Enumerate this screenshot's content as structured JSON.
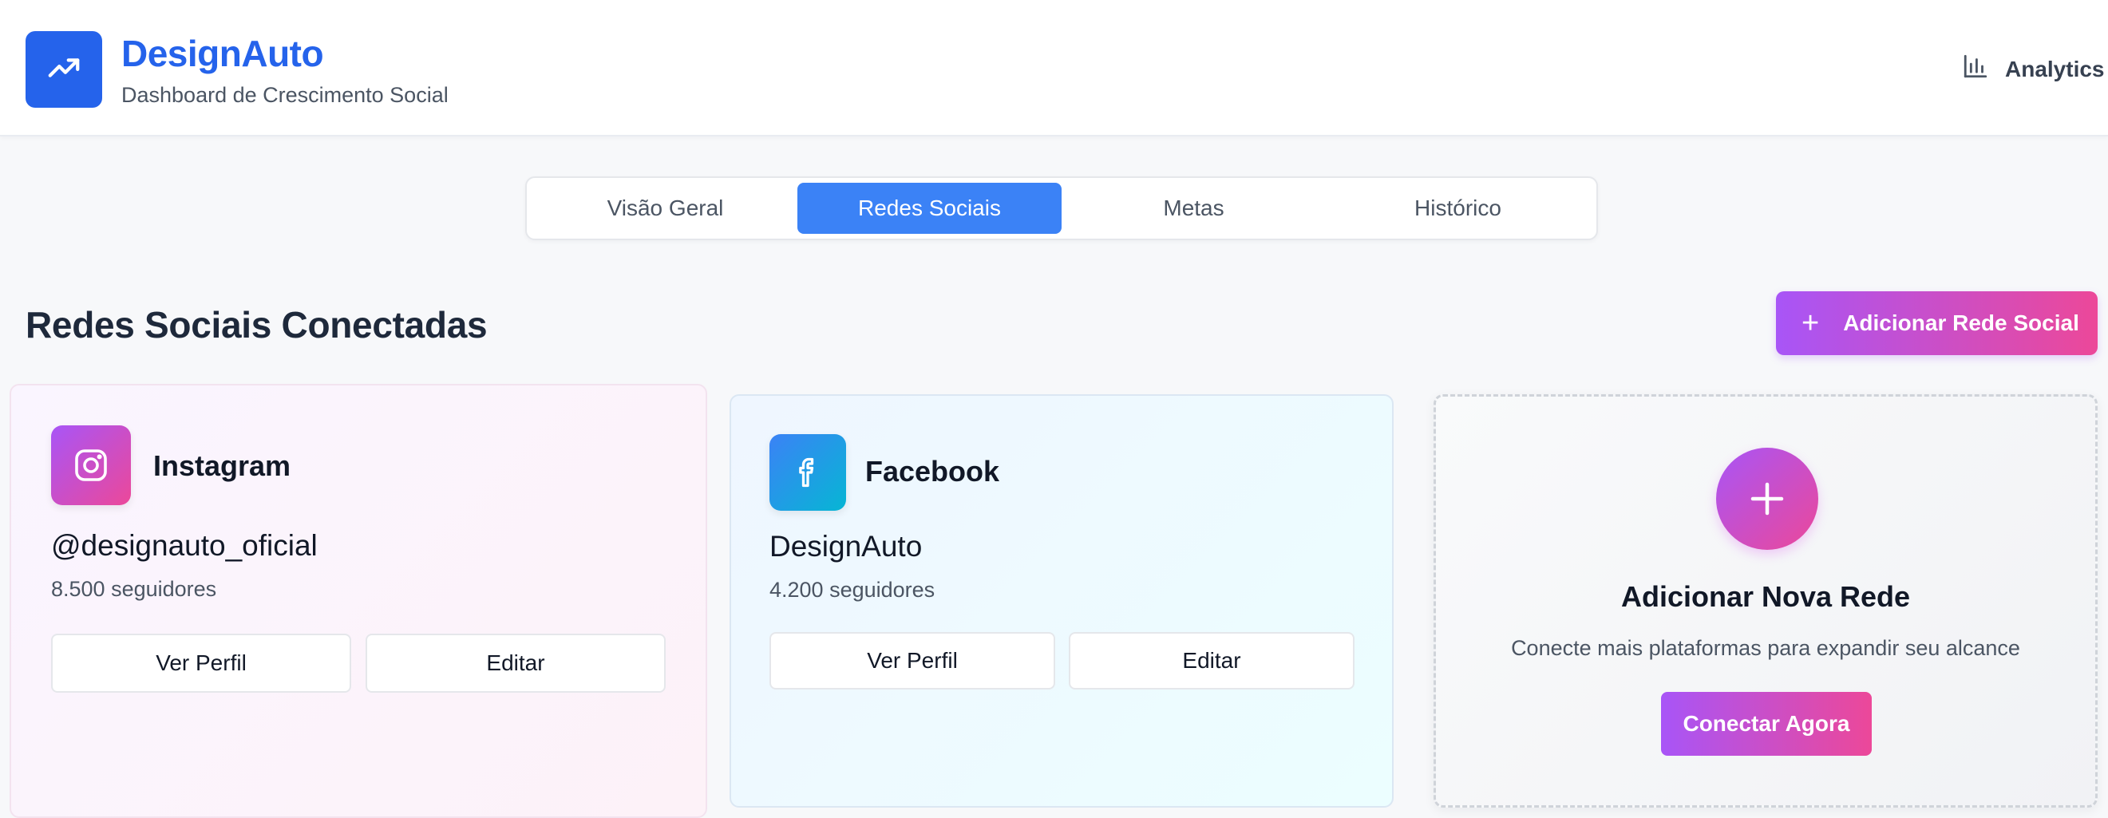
{
  "header": {
    "brand_name": "DesignAuto",
    "brand_subtitle": "Dashboard de Crescimento Social",
    "logo_icon": "trending-up-icon",
    "analytics_label": "Analytics",
    "analytics_icon": "bar-chart-icon"
  },
  "tabs": [
    {
      "label": "Visão Geral",
      "active": false
    },
    {
      "label": "Redes Sociais",
      "active": true
    },
    {
      "label": "Metas",
      "active": false
    },
    {
      "label": "Histórico",
      "active": false
    }
  ],
  "section": {
    "title": "Redes Sociais Conectadas",
    "add_button_label": "Adicionar Rede Social"
  },
  "networks": [
    {
      "name": "Instagram",
      "icon": "instagram-icon",
      "handle": "@designauto_oficial",
      "followers": "8.500 seguidores",
      "view_label": "Ver Perfil",
      "edit_label": "Editar"
    },
    {
      "name": "Facebook",
      "icon": "facebook-icon",
      "handle": "DesignAuto",
      "followers": "4.200 seguidores",
      "view_label": "Ver Perfil",
      "edit_label": "Editar"
    }
  ],
  "add_card": {
    "title": "Adicionar Nova Rede",
    "description": "Conecte mais plataformas para expandir seu alcance",
    "button_label": "Conectar Agora",
    "icon": "plus-icon"
  },
  "colors": {
    "primary": "#2563eb",
    "tab_active": "#3b82f6",
    "gradient_start": "#a855f7",
    "gradient_end": "#ec4899"
  }
}
